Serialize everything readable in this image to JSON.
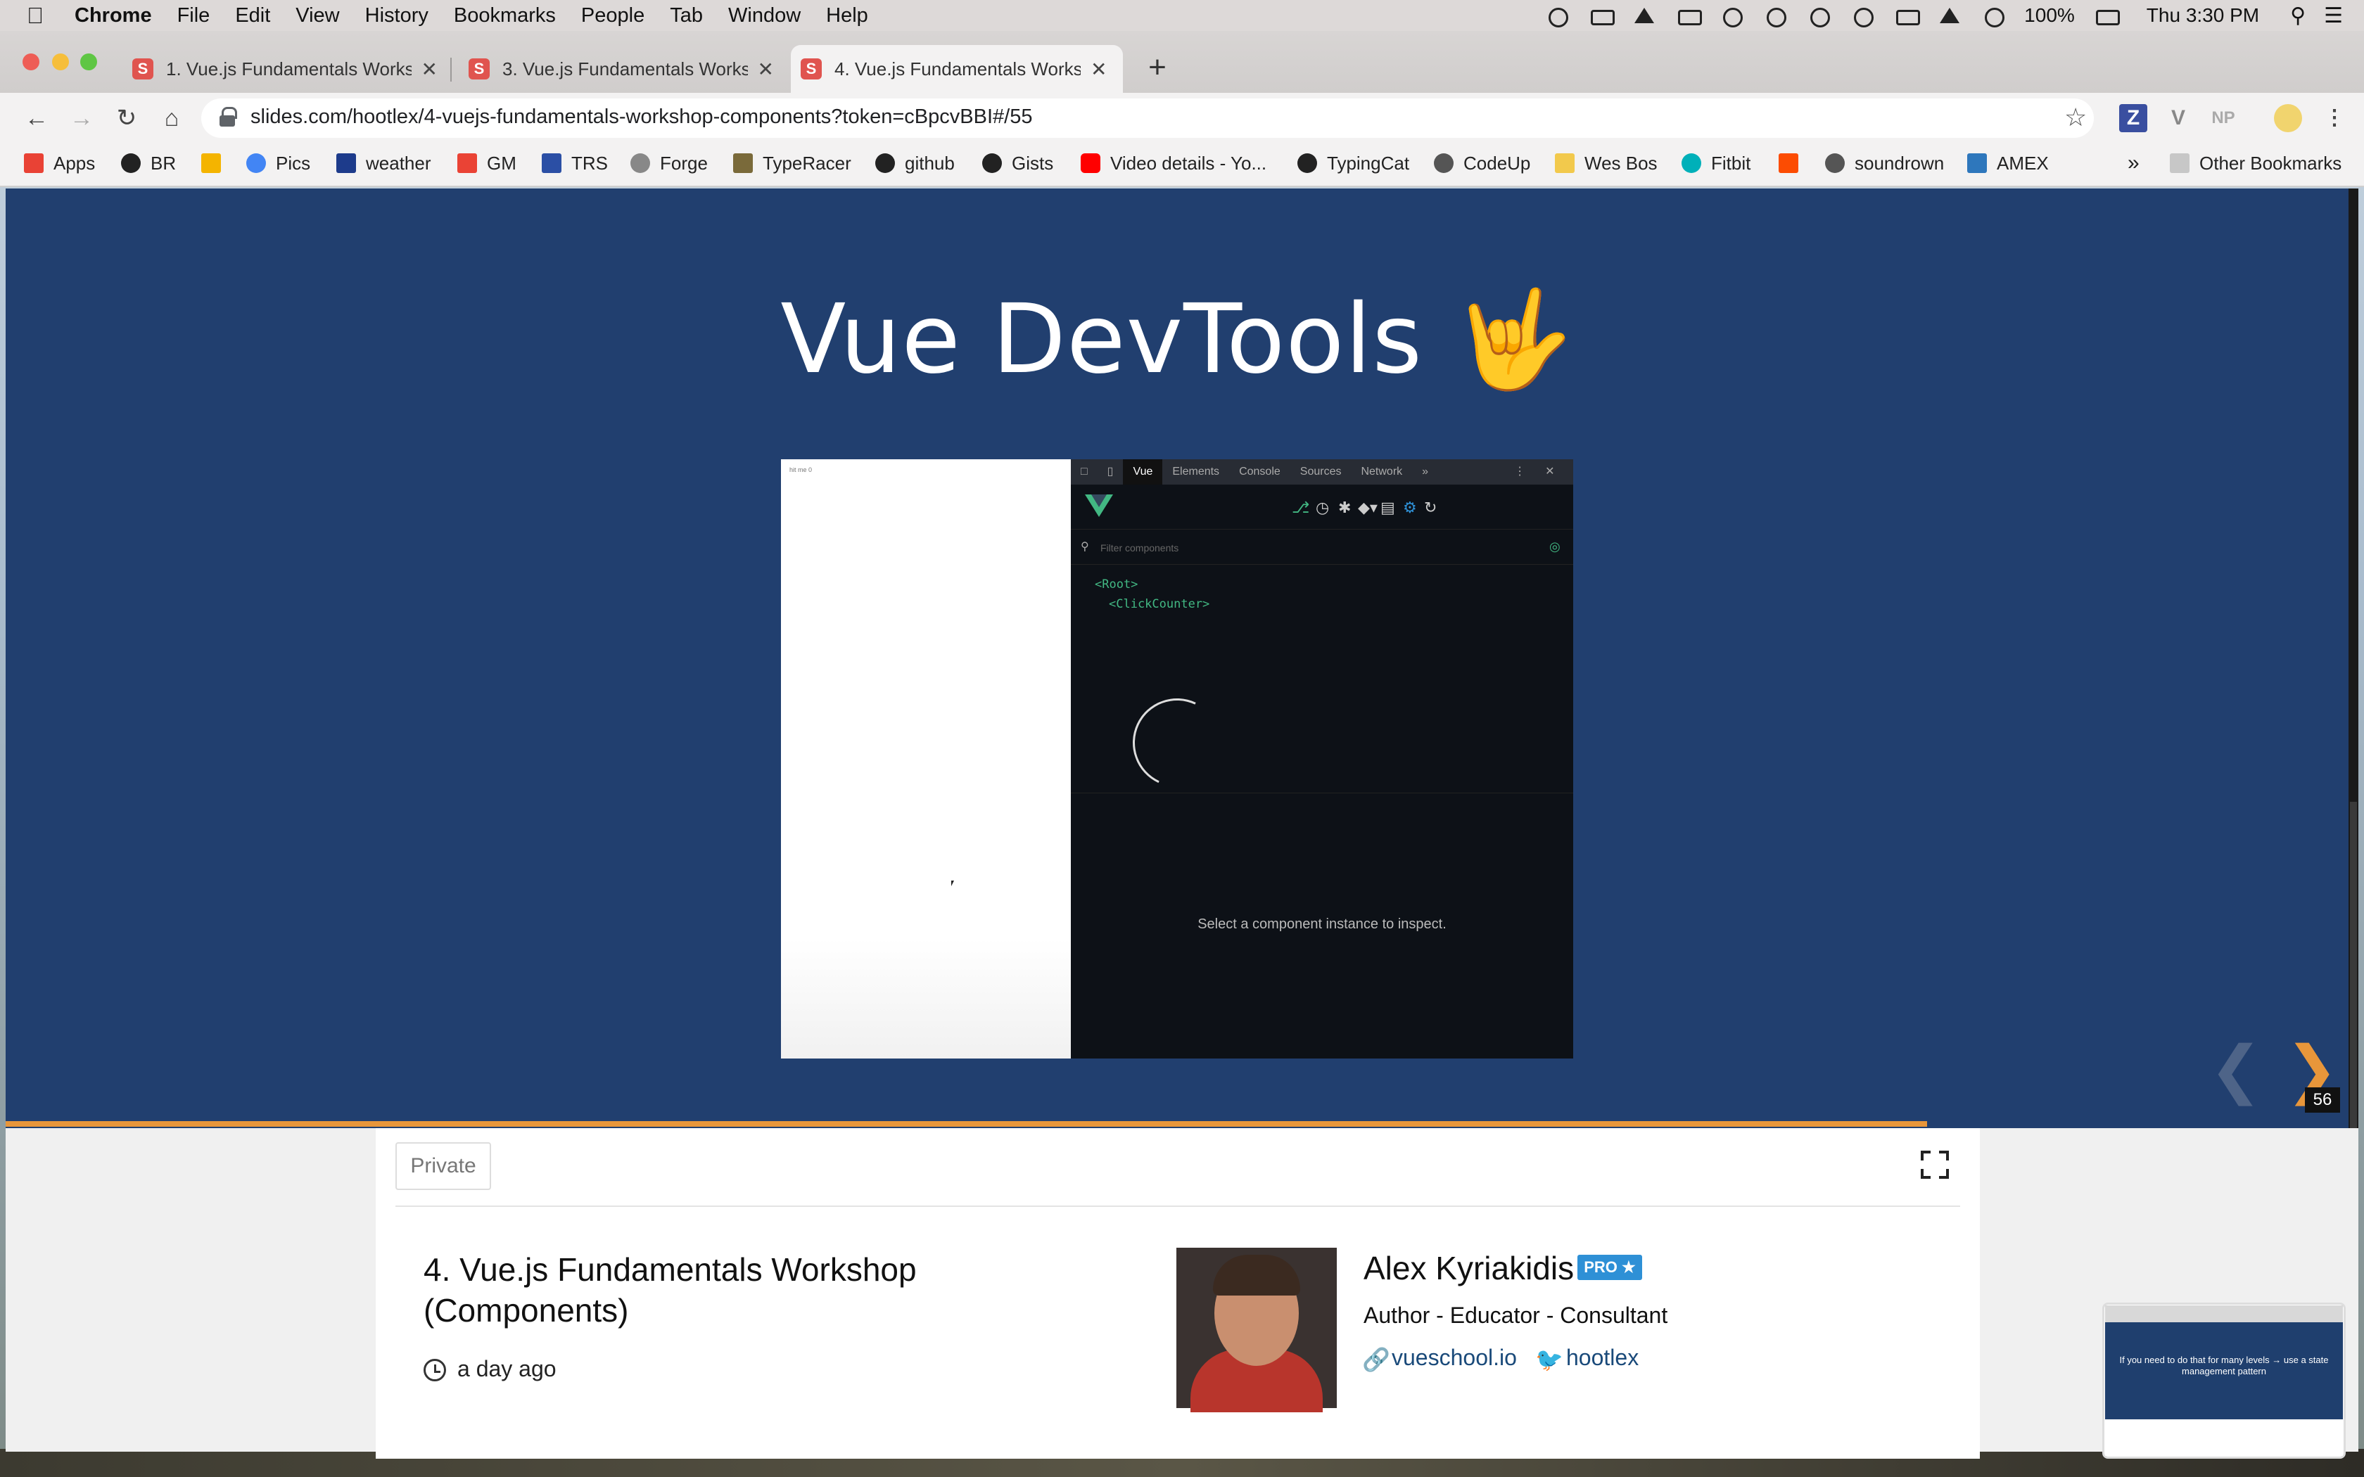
{
  "menubar": {
    "app": "Chrome",
    "items": [
      "File",
      "Edit",
      "View",
      "History",
      "Bookmarks",
      "People",
      "Tab",
      "Window",
      "Help"
    ],
    "battery": "100%",
    "clock": "Thu 3:30 PM"
  },
  "tabs": [
    {
      "title": "1. Vue.js Fundamentals Worksh",
      "favicon": "S"
    },
    {
      "title": "3. Vue.js Fundamentals Worksh",
      "favicon": "S"
    },
    {
      "title": "4. Vue.js Fundamentals Worksh",
      "favicon": "S"
    }
  ],
  "address_bar": {
    "url": "slides.com/hootlex/4-vuejs-fundamentals-workshop-components?token=cBpcvBBI#/55"
  },
  "extensions": [
    "Z",
    "V",
    "NP"
  ],
  "bookmarks": [
    "Apps",
    "BR",
    "",
    "Pics",
    "weather",
    "GM",
    "TRS",
    "Forge",
    "TypeRacer",
    "github",
    "Gists",
    "Video details - Yo...",
    "TypingCat",
    "CodeUp",
    "Wes Bos",
    "Fitbit",
    "",
    "soundrown",
    "AMEX"
  ],
  "bookmarks_more": "»",
  "other_bookmarks": "Other Bookmarks",
  "slide": {
    "title": "Vue DevTools 🤟",
    "number": "56",
    "progress": 0.82,
    "screenshot": {
      "page_text": "hit me 0",
      "devtools_tabs": [
        "Vue",
        "Elements",
        "Console",
        "Sources",
        "Network",
        "»"
      ],
      "filter_placeholder": "Filter components",
      "tree": [
        "<Root>",
        "<ClickCounter>"
      ],
      "message": "Select a component instance to inspect."
    }
  },
  "deck": {
    "visibility": "Private",
    "title": "4. Vue.js Fundamentals Workshop (Components)",
    "time": "a day ago"
  },
  "author": {
    "name": "Alex Kyriakidis",
    "badge": "PRO ★",
    "role": "Author - Educator - Consultant",
    "website": "vueschool.io",
    "twitter": "hootlex"
  },
  "mini_preview": {
    "text": "If you need to do that for many levels → use a state management pattern"
  },
  "colors": {
    "slide_bg": "#213f6f",
    "accent_orange": "#e8963a",
    "vue_green": "#42b883",
    "pro_blue": "#2e90d6"
  }
}
